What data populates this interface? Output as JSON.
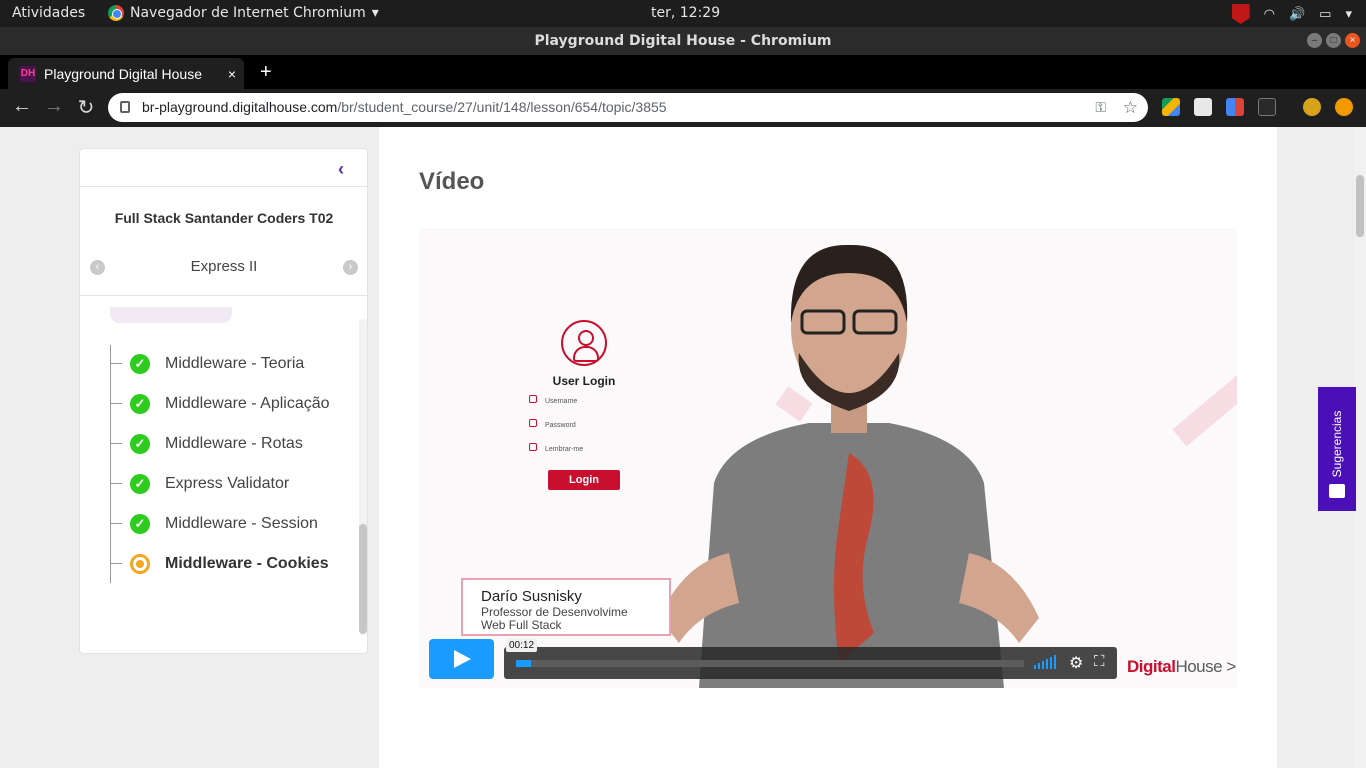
{
  "os": {
    "activities": "Atividades",
    "app_name": "Navegador de Internet Chromium",
    "app_arrow": "▾",
    "clock": "ter, 12:29",
    "wifi": "◠",
    "volume": "🔊",
    "battery": "▭",
    "menu_arrow": "▾"
  },
  "window": {
    "title": "Playground Digital House - Chromium",
    "minimize": "–",
    "maximize": "□",
    "close": "×"
  },
  "browser": {
    "tab_title": "Playground Digital House",
    "tab_favicon": "DH",
    "tab_close": "×",
    "new_tab": "+",
    "back": "←",
    "forward": "→",
    "reload": "↻",
    "url_host": "br-playground.digitalhouse.com",
    "url_path": "/br/student_course/27/unit/148/lesson/654/topic/3855",
    "key_icon": "⚿",
    "star_icon": "☆"
  },
  "sidebar": {
    "collapse": "‹",
    "course_title": "Full Stack Santander Coders T02",
    "unit": "Express II",
    "prev": "‹",
    "next": "›",
    "lessons": [
      {
        "label": "Middleware - Teoria",
        "status": "done",
        "mark": "✓"
      },
      {
        "label": "Middleware - Aplicação",
        "status": "done",
        "mark": "✓"
      },
      {
        "label": "Middleware - Rotas",
        "status": "done",
        "mark": "✓"
      },
      {
        "label": "Express Validator",
        "status": "done",
        "mark": "✓"
      },
      {
        "label": "Middleware - Session",
        "status": "done",
        "mark": "✓"
      },
      {
        "label": "Middleware - Cookies",
        "status": "current",
        "mark": ""
      }
    ]
  },
  "main": {
    "section_title": "Vídeo"
  },
  "video": {
    "login_title": "User Login",
    "username_label": "Username",
    "password_label": "Password",
    "remember_label": "Lembrar-me",
    "login_button": "Login",
    "presenter_name": "Darío Susnisky",
    "presenter_role_1": "Professor de Desenvolvime",
    "presenter_role_2": "Web Full Stack",
    "time_tooltip": "00:12",
    "progress_fraction": 0.03,
    "gear_icon": "⚙",
    "fullscreen_icon": "⛶",
    "brand_red": "Digital",
    "brand_gray": "House >"
  },
  "feedback": {
    "label": "Sugerencias"
  },
  "colors": {
    "accent_purple": "#5a2ab1",
    "done_green": "#2ecc1f",
    "current_orange": "#f5a623",
    "player_blue": "#1a9cff",
    "brand_red": "#c8102e",
    "feedback_purple": "#4b0fb8"
  }
}
